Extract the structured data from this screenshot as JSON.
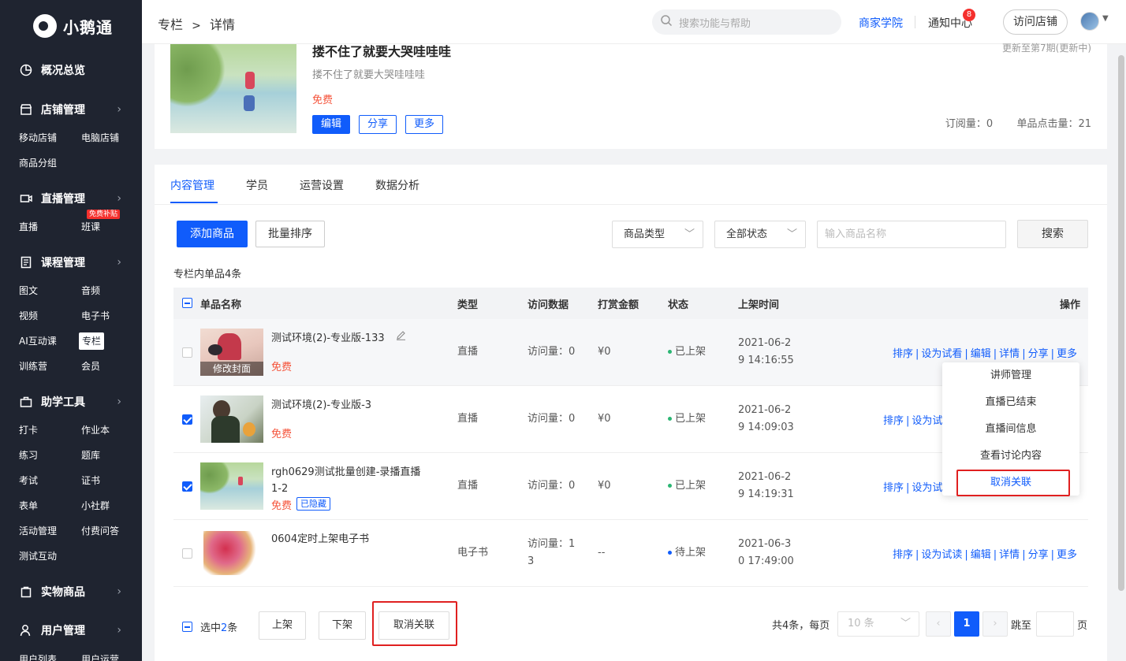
{
  "app": {
    "logo_text": "小鹅通"
  },
  "sidebar": {
    "groups": [
      {
        "label": "概况总览",
        "icon": "pie-chart-icon"
      },
      {
        "label": "店铺管理",
        "icon": "store-icon"
      },
      {
        "label": "直播管理",
        "icon": "video-icon"
      },
      {
        "label": "课程管理",
        "icon": "book-icon"
      },
      {
        "label": "助学工具",
        "icon": "toolbox-icon"
      },
      {
        "label": "实物商品",
        "icon": "bag-icon"
      },
      {
        "label": "用户管理",
        "icon": "user-icon"
      }
    ],
    "items": [
      "移动店铺",
      "电脑店铺",
      "商品分组",
      "直播",
      "班课",
      "图文",
      "音频",
      "视频",
      "电子书",
      "AI互动课",
      "专栏",
      "训练营",
      "会员",
      "打卡",
      "作业本",
      "练习",
      "题库",
      "考试",
      "证书",
      "表单",
      "小社群",
      "活动管理",
      "付费问答",
      "测试互动",
      "用户列表",
      "用户运营"
    ],
    "hot_badge": "免费补贴"
  },
  "header": {
    "breadcrumb": [
      "专栏",
      ">",
      "详情"
    ],
    "search_placeholder": "搜索功能与帮助",
    "academy": "商家学院",
    "notice": "通知中心",
    "notice_count": "8",
    "visit_store": "访问店铺"
  },
  "column": {
    "title": "搂不住了就要大哭哇哇哇",
    "desc": "搂不住了就要大哭哇哇哇",
    "price": "免费",
    "btn_edit": "编辑",
    "btn_share": "分享",
    "btn_more": "更多",
    "update": "更新至第7期(更新中)",
    "subscribe": "订阅量：0",
    "clicks": "单品点击量：21"
  },
  "tabs": [
    "内容管理",
    "学员",
    "运营设置",
    "数据分析"
  ],
  "toolbar": {
    "add": "添加商品",
    "batch_sort": "批量排序",
    "type_select": "商品类型",
    "status_select": "全部状态",
    "search_placeholder": "输入商品名称",
    "search_btn": "搜索"
  },
  "count_text": "专栏内单品4条",
  "table": {
    "headers": [
      "单品名称",
      "类型",
      "访问数据",
      "打赏金额",
      "状态",
      "上架时间",
      "操作"
    ],
    "rows": [
      {
        "name": "测试环境(2)-专业版-133",
        "price": "免费",
        "type": "直播",
        "visits": "访问量：0",
        "reward": "¥0",
        "status": "已上架",
        "time1": "2021-06-2",
        "time2": "9 14:16:55",
        "checked": false,
        "cover_caption": "修改封面",
        "ops": [
          "排序",
          "设为试看",
          "编辑",
          "详情",
          "分享",
          "更多"
        ]
      },
      {
        "name": "测试环境(2)-专业版-3",
        "price": "免费",
        "type": "直播",
        "visits": "访问量：0",
        "reward": "¥0",
        "status": "已上架",
        "time1": "2021-06-2",
        "time2": "9 14:09:03",
        "checked": true,
        "ops": [
          "排序",
          "设为试"
        ]
      },
      {
        "name": "rgh0629测试批量创建-录播直播1-2",
        "price": "免费",
        "tag": "已隐藏",
        "type": "直播",
        "visits": "访问量：0",
        "reward": "¥0",
        "status": "已上架",
        "time1": "2021-06-2",
        "time2": "9 14:19:31",
        "checked": true,
        "ops": [
          "排序",
          "设为试"
        ]
      },
      {
        "name": "0604定时上架电子书",
        "price": "",
        "type": "电子书",
        "visits": "访问量：1",
        "visits2": "3",
        "reward": "--",
        "status": "待上架",
        "time1": "2021-06-3",
        "time2": "0 17:49:00",
        "checked": false,
        "ops": [
          "排序",
          "设为试读",
          "编辑",
          "详情",
          "分享",
          "更多"
        ]
      }
    ]
  },
  "dropdown": [
    "讲师管理",
    "直播已结束",
    "直播间信息",
    "查看讨论内容",
    "取消关联"
  ],
  "bottom": {
    "selected_prefix": "选中",
    "selected_count": "2",
    "selected_suffix": "条",
    "on_shelf": "上架",
    "off_shelf": "下架",
    "unlink": "取消关联",
    "total": "共4条，每页",
    "page_size": "10 条",
    "current_page": "1",
    "jump_label": "跳至",
    "page_suffix": "页"
  },
  "colors": {
    "accent": "#105cfb",
    "sidebar": "#1f2430",
    "price": "#f5543b",
    "highlight_border": "#e02020",
    "status_on": "#2bb673",
    "status_pending": "#105cfb"
  }
}
